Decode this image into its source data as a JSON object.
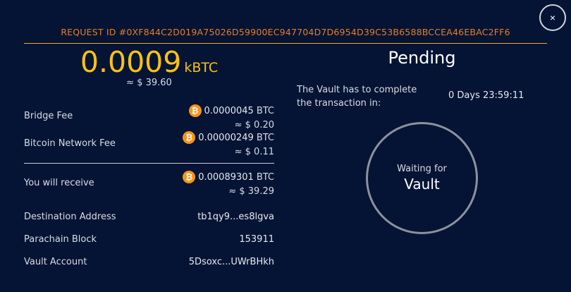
{
  "modal": {
    "close_icon": "×",
    "request_id": "REQUEST ID #0XF844C2D019A75026D59900EC947704D7D6954D39C53B6588BCCEA46EBAC2FF6"
  },
  "amount": {
    "value": "0.0009",
    "unit": "kBTC",
    "usd": "≈ $ 39.60"
  },
  "fees": [
    {
      "label": "Bridge Fee",
      "btc": "0.0000045",
      "unit": "BTC",
      "usd": "≈ $ 0.20"
    },
    {
      "label": "Bitcoin Network Fee",
      "btc": "0.00000249",
      "unit": "BTC",
      "usd": "≈ $ 0.11"
    }
  ],
  "receive": {
    "label": "You will receive",
    "btc": "0.00089301",
    "unit": "BTC",
    "usd": "≈ $ 39.29"
  },
  "details": [
    {
      "label": "Destination Address",
      "value": "tb1qy9...es8lgva"
    },
    {
      "label": "Parachain Block",
      "value": "153911"
    },
    {
      "label": "Vault Account",
      "value": "5Dsoxc...UWrBHkh"
    }
  ],
  "status": {
    "title": "Pending",
    "vault_text": "The Vault has to complete the transaction in:",
    "countdown": "0 Days 23:59:11",
    "waiting_line1": "Waiting for",
    "waiting_line2": "Vault"
  },
  "icons": {
    "bitcoin": "bitcoin-icon",
    "close": "close-icon"
  },
  "colors": {
    "background": "#051434",
    "accent": "#f7c212",
    "request_id": "#e67e22",
    "bitcoin": "#f7931a"
  }
}
